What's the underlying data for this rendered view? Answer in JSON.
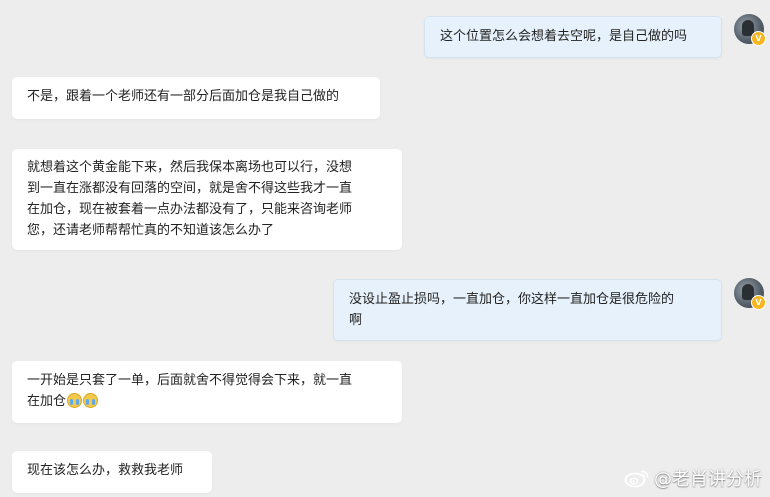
{
  "messages": [
    {
      "side": "out",
      "text": "这个位置怎么会想着去空呢，是自己做的吗"
    },
    {
      "side": "in",
      "text": "不是，跟着一个老师还有一部分后面加仓是我自己做的"
    },
    {
      "side": "in",
      "lines": [
        "就想着这个黄金能下来，然后我保本离场也可以行，没想",
        "到一直在涨都没有回落的空间，就是舍不得这些我才一直",
        "在加仓，现在被套着一点办法都没有了，只能来咨询老师",
        "您，还请老师帮帮忙真的不知道该怎么办了"
      ]
    },
    {
      "side": "out",
      "lines": [
        "没设止盈止损吗，一直加仓，你这样一直加仓是很危险的",
        "啊"
      ]
    },
    {
      "side": "in",
      "lines": [
        "一开始是只套了一单，后面就舍不得觉得会下来，就一直",
        "在加仓"
      ],
      "emojis": [
        "crying-face",
        "crying-face"
      ]
    },
    {
      "side": "in",
      "text": "现在该怎么办，救救我老师"
    }
  ],
  "avatar_badge": "V",
  "watermark": {
    "text": "@老肖讲分析",
    "icon": "weibo-logo-icon"
  },
  "colors": {
    "background": "#ededed",
    "incoming_bubble": "#ffffff",
    "outgoing_bubble": "#e6f1fb",
    "verified_badge": "#f6b622"
  }
}
